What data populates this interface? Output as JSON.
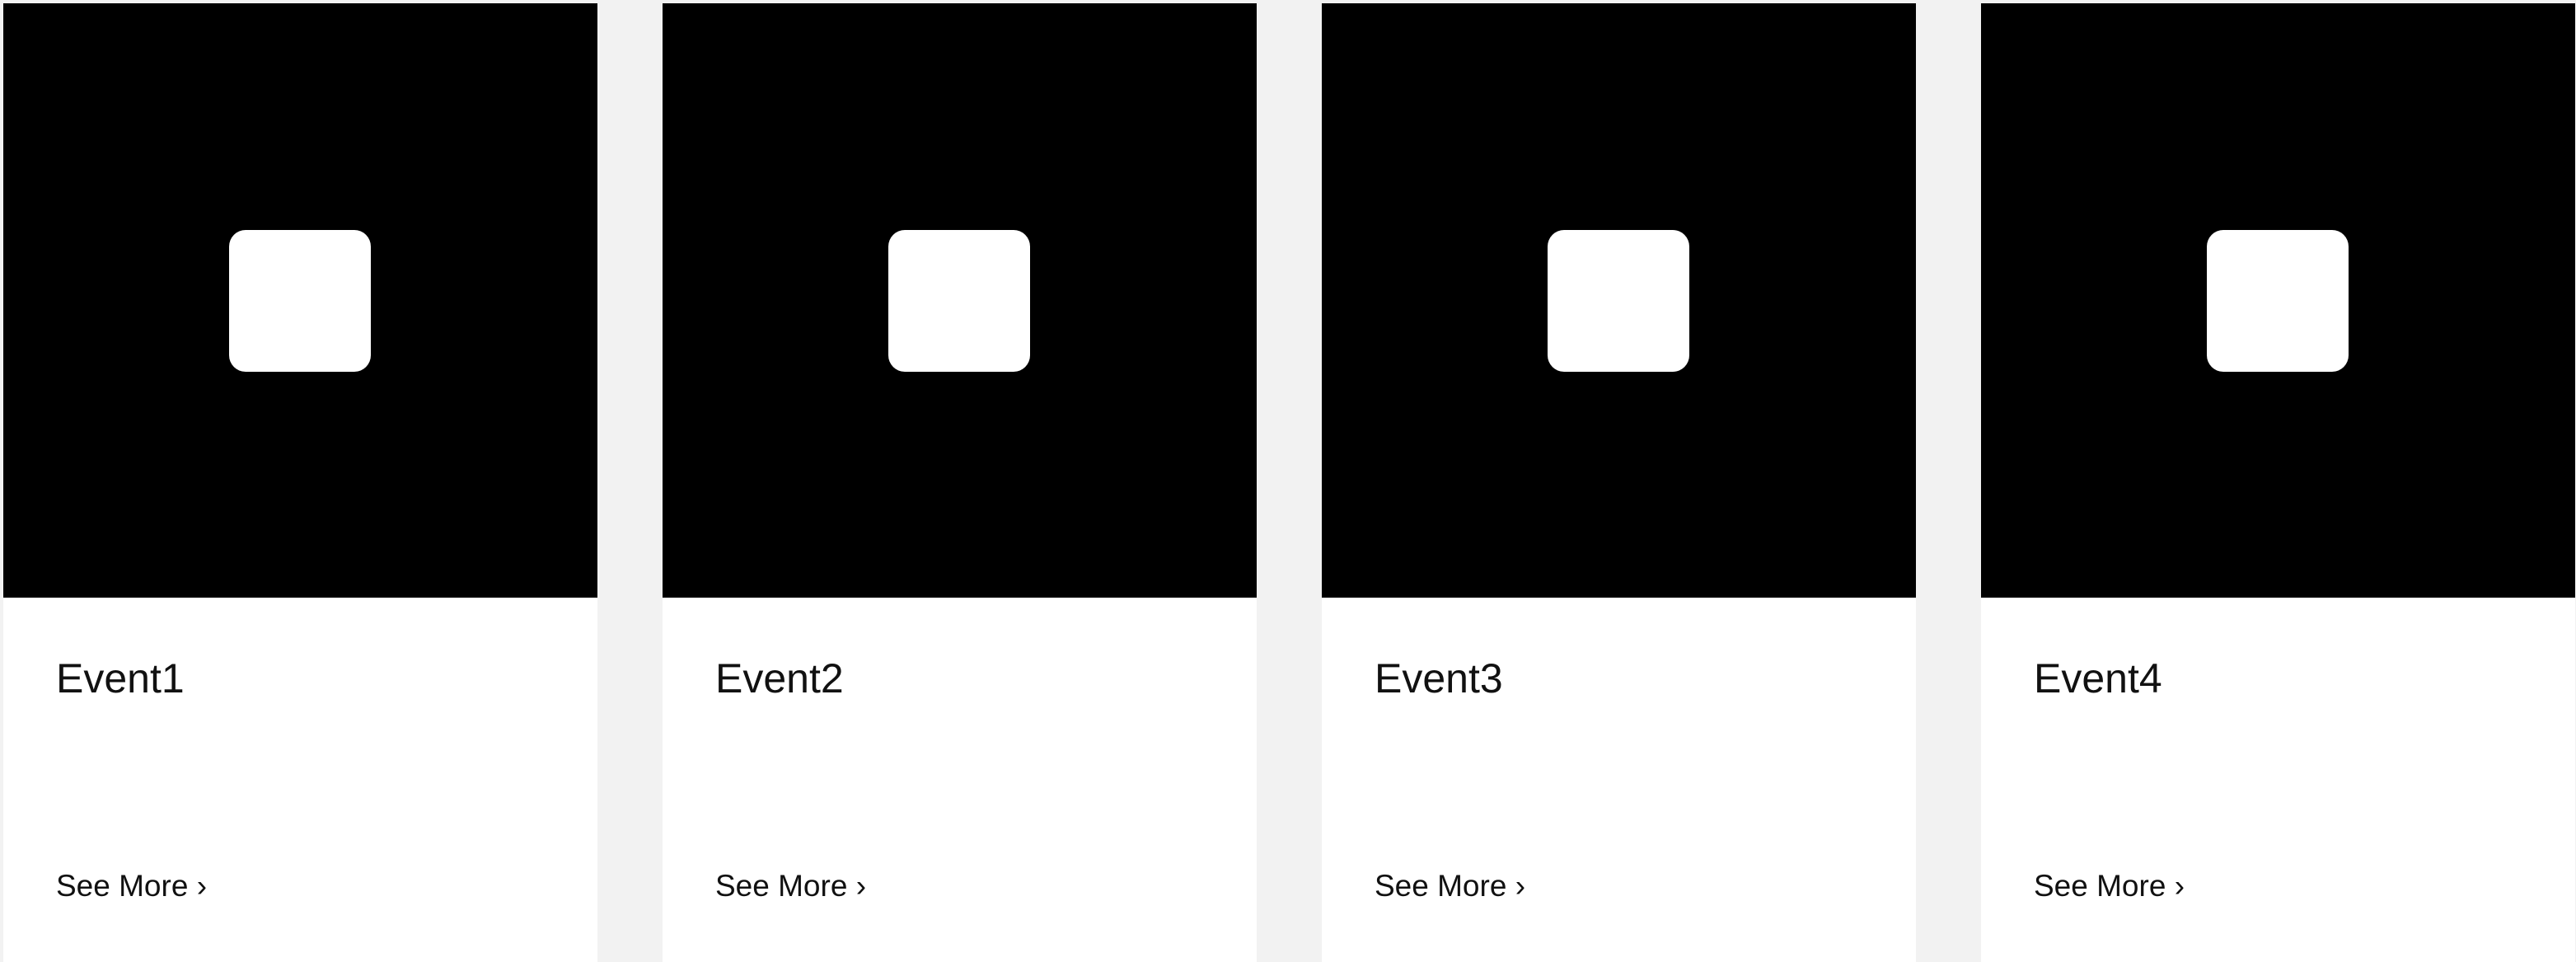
{
  "events": [
    {
      "title": "Event1",
      "link_label": "See More ›"
    },
    {
      "title": "Event2",
      "link_label": "See More ›"
    },
    {
      "title": "Event3",
      "link_label": "See More ›"
    },
    {
      "title": "Event4",
      "link_label": "See More ›"
    }
  ],
  "colors": {
    "page_background": "#f2f2f2",
    "card_background": "#ffffff",
    "image_background": "#000000",
    "placeholder_icon": "#ffffff",
    "text": "#111111"
  },
  "icons": {
    "image_placeholder": "image-placeholder-icon"
  }
}
